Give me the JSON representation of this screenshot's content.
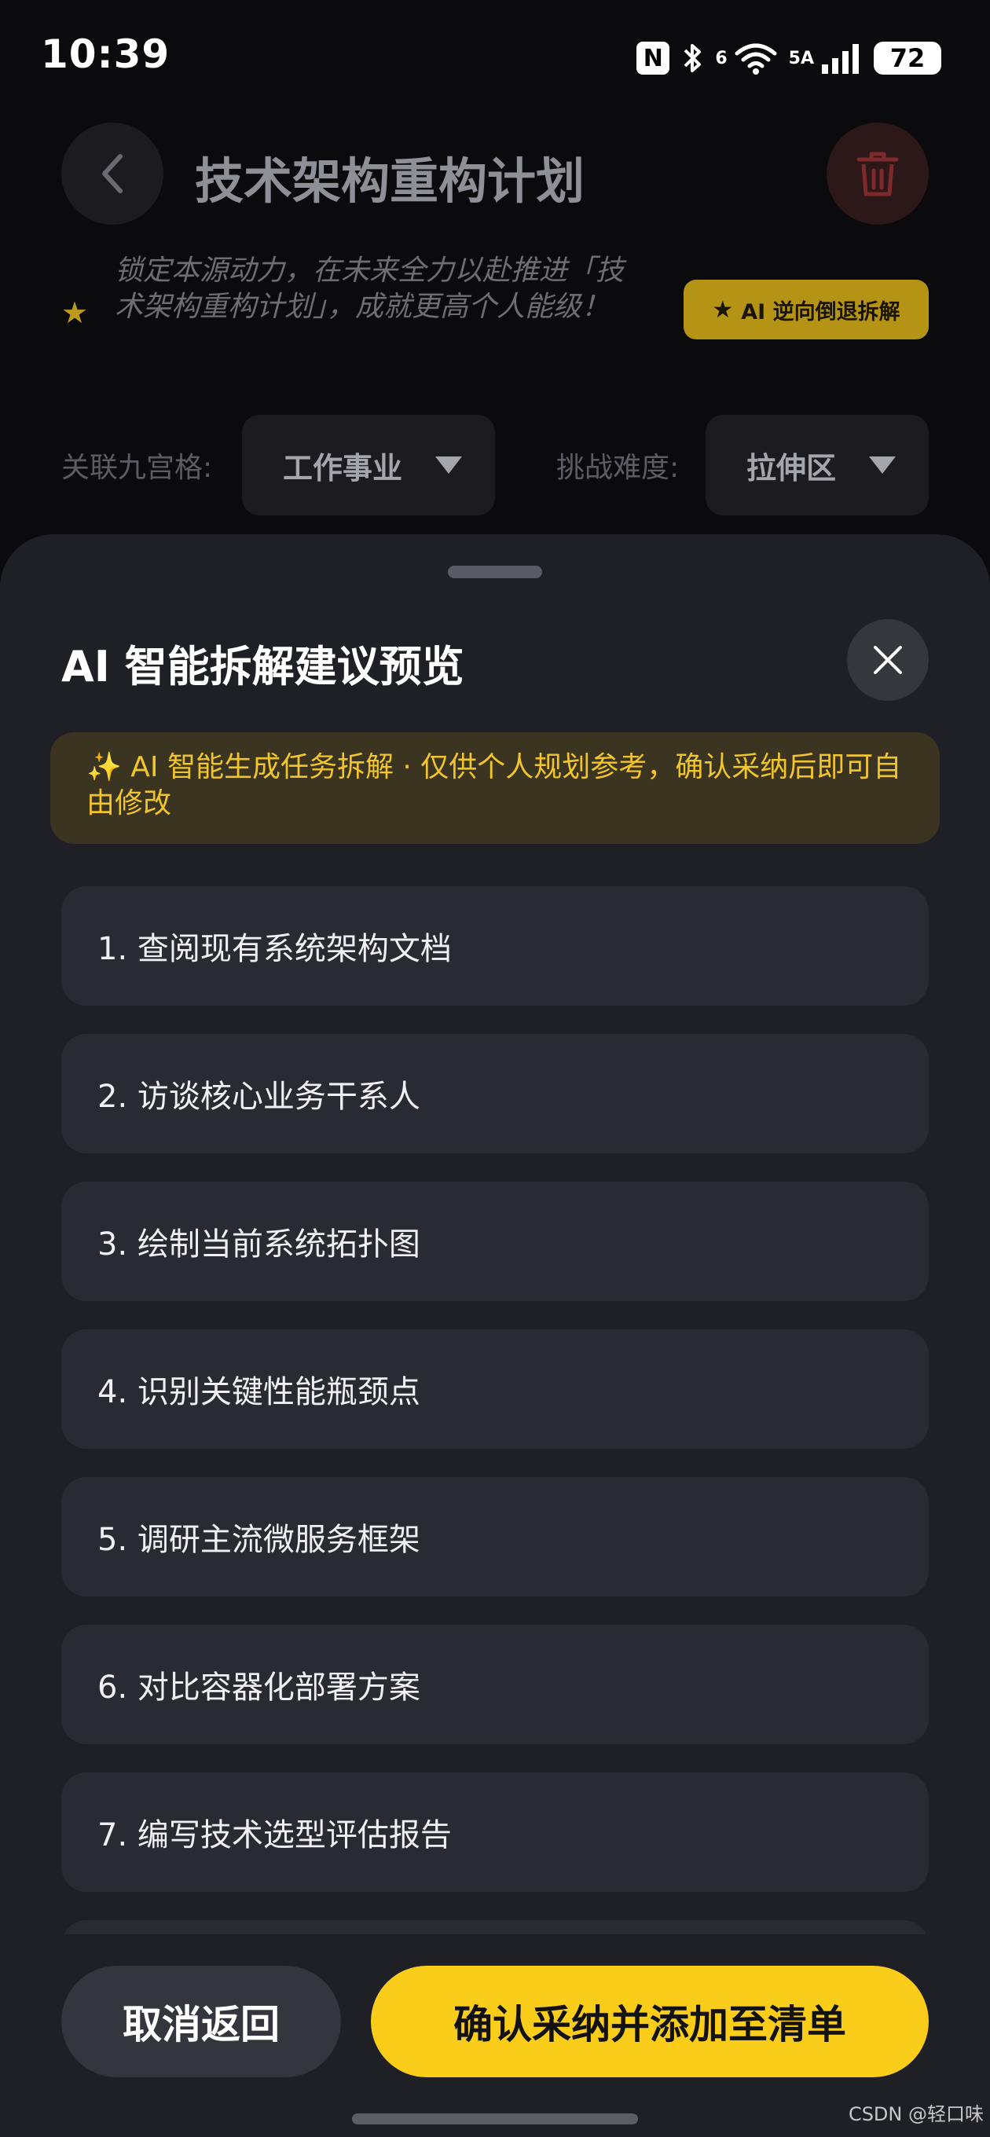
{
  "status_bar": {
    "time": "10:39",
    "nfc_label": "N",
    "network_label": "5A",
    "wifi_label": "6",
    "battery": "72",
    "icons": [
      "nfc-icon",
      "bluetooth-icon",
      "wifi-icon",
      "signal-icon",
      "battery-icon"
    ]
  },
  "page": {
    "title": "技术架构重构计划",
    "motto": "锁定本源动力，在未来全力以赴推进「技术架构重构计划」，成就更高个人能级！",
    "ai_reverse_button": "AI 逆向倒退拆解",
    "grid_label": "关联九宫格:",
    "grid_value": "工作事业",
    "difficulty_label": "挑战难度:",
    "difficulty_value": "拉伸区"
  },
  "sheet": {
    "title": "AI 智能拆解建议预览",
    "notice": "✨ AI 智能生成任务拆解 · 仅供个人规划参考，确认采纳后即可自由修改",
    "tasks": [
      "1. 查阅现有系统架构文档",
      "2. 访谈核心业务干系人",
      "3. 绘制当前系统拓扑图",
      "4. 识别关键性能瓶颈点",
      "5. 调研主流微服务框架",
      "6. 对比容器化部署方案",
      "7. 编写技术选型评估报告",
      ""
    ],
    "cancel_button": "取消返回",
    "confirm_button": "确认采纳并添加至清单"
  },
  "watermark": "CSDN @轻口味",
  "colors": {
    "accent": "#fbcd1b",
    "sheet_bg": "#1f1f26",
    "item_bg": "#2a2a33",
    "notice_text": "#f2c52a"
  }
}
